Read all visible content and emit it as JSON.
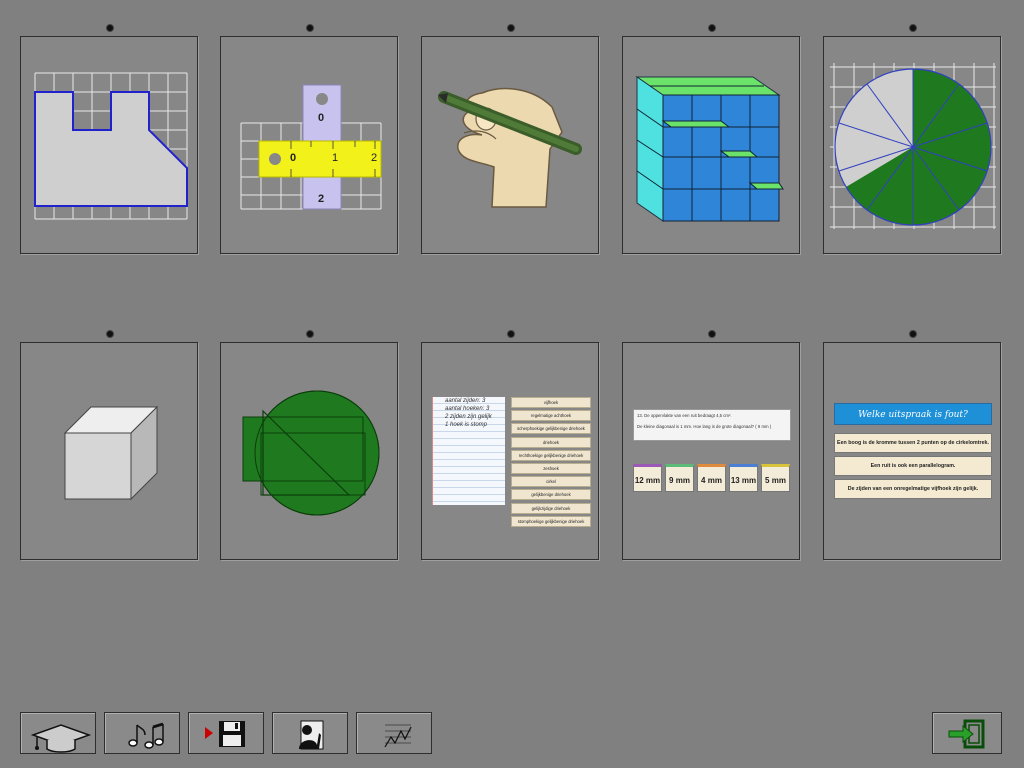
{
  "ruler": {
    "top_labels": [
      "0",
      "2"
    ],
    "bottom_labels": [
      "0",
      "1",
      "2"
    ]
  },
  "triangle_card": {
    "notebook_lines": [
      "aantal zijden: 3",
      "aantal hoeken: 3",
      "2 zijden zijn gelijk",
      "1 hoek is stomp"
    ],
    "choices": [
      "vijfhoek",
      "regelmatige achthoek",
      "scherphoekige gelijkbenige driehoek",
      "driehoek",
      "rechthoekige gelijkbenige driehoek",
      "zeshoek",
      "cirkel",
      "gelijkbenige driehoek",
      "gelijkzijdige driehoek",
      "stomphoekige gelijkbenige driehoek"
    ]
  },
  "rhombus_card": {
    "question_line1": "13. De oppervlakte van een ruit bedraagt 4,5 cm².",
    "question_line2": "De kleine diagonaal is 1 mm. Hoe lang is de grote diagonaal? ( 9 mm )",
    "answers": [
      {
        "label": "12 mm",
        "color": "#9b59b6"
      },
      {
        "label": "9 mm",
        "color": "#5dbb7a"
      },
      {
        "label": "4 mm",
        "color": "#e08a3c"
      },
      {
        "label": "13 mm",
        "color": "#4a7fd4"
      },
      {
        "label": "5 mm",
        "color": "#d8c43a"
      }
    ]
  },
  "statements_card": {
    "title": "Welke uitspraak is fout?",
    "statements": [
      "Een boog is de kromme tussen 2 punten op de cirkelomtrek.",
      "Een ruit is ook een parallelogram.",
      "De zijden van een onregelmatige vijfhoek zijn gelijk."
    ]
  },
  "icons": {
    "row1": [
      "grid-shape-icon",
      "measuring-tape-icon",
      "hand-pencil-icon",
      "cube-blocks-icon",
      "pie-fraction-icon"
    ],
    "row2": [
      "cube-icon",
      "circle-construction-icon",
      "shape-names-icon",
      "quiz-answers-icon",
      "statements-icon"
    ],
    "toolbar": [
      "graduation-cap-icon",
      "music-notes-icon",
      "save-disk-icon",
      "teacher-icon",
      "progress-chart-icon",
      "exit-icon"
    ]
  },
  "colors": {
    "background": "#808080",
    "card": "#878787",
    "green": "#1f7a1f",
    "blue_block": "#2f86d8",
    "yellow": "#f2f21a"
  }
}
